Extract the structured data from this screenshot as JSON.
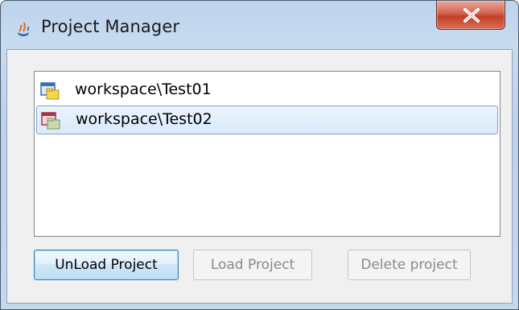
{
  "window": {
    "title": "Project Manager",
    "app_icon": "java-cup-icon",
    "close_icon": "close-x-icon",
    "close_label": "X"
  },
  "projects": [
    {
      "label": "workspace\\Test01",
      "icon": "project-folder-blue-icon",
      "selected": false
    },
    {
      "label": "workspace\\Test02",
      "icon": "project-folder-red-icon",
      "selected": true
    }
  ],
  "buttons": {
    "unload": "UnLoad Project",
    "load": "Load Project",
    "delete": "Delete project"
  },
  "colors": {
    "selection_border": "#7da2ce",
    "close_button": "#c33f27",
    "primary_border": "#3c7fb1"
  }
}
